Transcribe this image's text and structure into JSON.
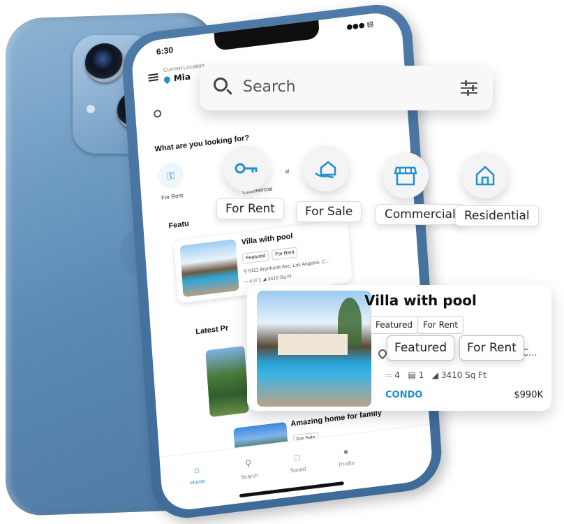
{
  "status_bar": {
    "time": "6:30",
    "icons": "●●● ▤"
  },
  "location": {
    "label": "Current Location",
    "value": "Mia"
  },
  "search": {
    "placeholder": "Search",
    "inner_placeholder": "S"
  },
  "categories_section": {
    "title": "What are you looking for?"
  },
  "small_categories": [
    {
      "label": "For Rent",
      "icon": "key-icon"
    },
    {
      "label": "Commercial",
      "icon": "store-icon"
    },
    {
      "label": "al",
      "icon": "home-icon"
    }
  ],
  "floating_categories": [
    {
      "label": "For Rent",
      "icon": "key-icon"
    },
    {
      "label": "For Sale",
      "icon": "hand-house-icon"
    },
    {
      "label": "Commercial",
      "icon": "store-icon"
    },
    {
      "label": "Residential",
      "icon": "house-icon"
    }
  ],
  "featured_section": {
    "title": "Featu"
  },
  "featured_card": {
    "title": "Villa with pool",
    "tags": [
      "Featured",
      "For Rent"
    ],
    "address": "6111 Brynhurst Ave, Los Angeles, C...",
    "beds": "4",
    "baths": "1",
    "area": "3410 Sq Ft"
  },
  "big_card": {
    "title": "Villa with pool",
    "tags": [
      "Featured",
      "For Rent"
    ],
    "tags_zoomed": [
      "Featured",
      "For Rent"
    ],
    "address_tail": "C...",
    "beds": "4",
    "baths": "1",
    "area": "3410 Sq Ft",
    "type": "CONDO",
    "price": "$990K"
  },
  "latest_section": {
    "title": "Latest Pr"
  },
  "latest_items": [
    {
      "title": "Amazing home for family",
      "tag": "For Sale"
    }
  ],
  "bottom_nav": [
    {
      "label": "Home",
      "icon": "home-icon",
      "active": true
    },
    {
      "label": "Search",
      "icon": "search-icon",
      "active": false
    },
    {
      "label": "Saved",
      "icon": "bookmark-icon",
      "active": false
    },
    {
      "label": "Profile",
      "icon": "person-icon",
      "active": false
    }
  ],
  "colors": {
    "accent": "#1f8fd0",
    "phone_blue": "#5a88b3",
    "text": "#222222"
  }
}
